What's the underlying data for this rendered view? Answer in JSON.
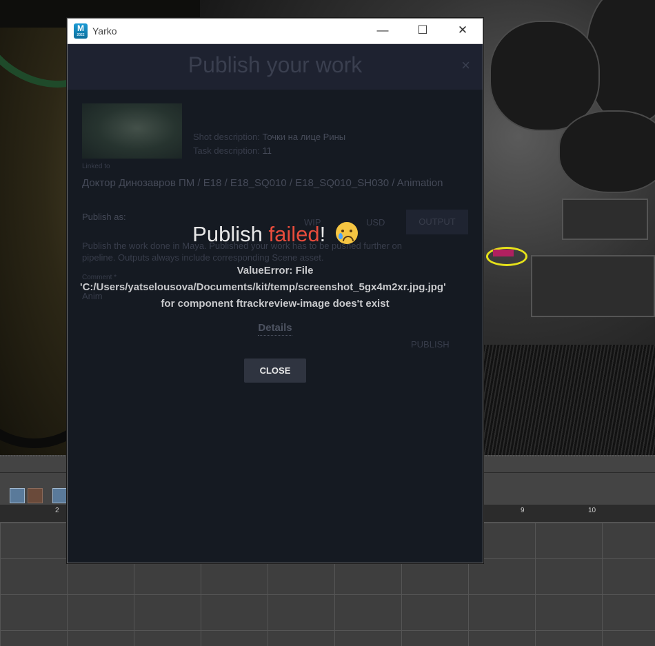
{
  "window": {
    "title": "Yarko",
    "app_icon_letter": "M",
    "app_icon_sub": "2022",
    "minimize": "—",
    "maximize": "☐",
    "close": "✕"
  },
  "publish_form": {
    "header_title": "Publish your work",
    "header_close": "×",
    "shot_description_label": "Shot description:",
    "shot_description_value": "Точки на лице Рины",
    "task_description_label": "Task description:",
    "task_description_value": "11",
    "linked_to_label": "Linked to",
    "linked_path": "Доктор Динозавров ПМ / E18 / E18_SQ010 / E18_SQ010_SH030 / Animation",
    "publish_as_label": "Publish as:",
    "options": [
      "WIP",
      "USD"
    ],
    "output_button": "OUTPUT",
    "description_line1": "Publish the work done in Maya. Published your work has to be pushed further on",
    "description_line2": "pipeline. Outputs always include corresponding Scene asset.",
    "comment_label": "Comment *",
    "comment_value": "Anim",
    "publish_button": "PUBLISH"
  },
  "failure": {
    "title_prefix": "Publish ",
    "title_failed": "failed",
    "title_suffix": "!",
    "error_line1": "ValueError: File",
    "error_line2": "'C:/Users/yatselousova/Documents/kit/temp/screenshot_5gx4m2xr.jpg.jpg'",
    "error_line3": "for component ftrackreview-image does't exist",
    "details_link": "Details",
    "close_button": "CLOSE"
  },
  "timeline": {
    "ruler_labels": [
      "2",
      "9",
      "10"
    ]
  },
  "colors": {
    "accent_error": "#e74c3c",
    "dialog_bg": "#151a22",
    "button_bg": "#2f3440"
  }
}
